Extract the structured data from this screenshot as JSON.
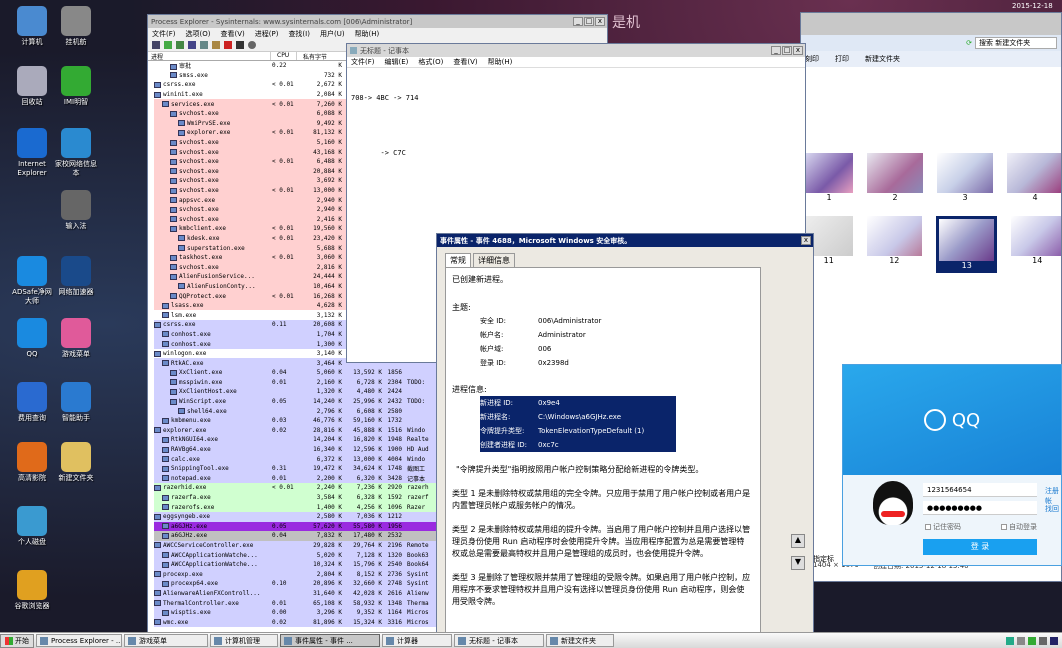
{
  "desktop": {
    "top_text": "是机",
    "date_time": "2015-12-18",
    "icons": [
      "计算机",
      "挂机舫",
      "回收站",
      "IMI明智",
      "Internet Explorer",
      "家校网络信息本",
      "输入法",
      "ADSafe净网大师",
      "网络加速器",
      "QQ",
      "游戏菜单",
      "费用查询",
      "智能助手",
      "高清影院",
      "新建文件夹",
      "个人磁盘",
      "谷歌浏览器"
    ]
  },
  "procexp": {
    "title": "Process Explorer - Sysinternals: www.sysinternals.com [006\\Administrator]",
    "menu": [
      "文件(F)",
      "选项(O)",
      "查看(V)",
      "进程(P)",
      "查找(I)",
      "用户(U)",
      "帮助(H)"
    ],
    "columns": [
      "进程",
      "CPU",
      "私有字节"
    ],
    "rows": [
      [
        "审批",
        "0.22",
        "K",
        "",
        "",
        ""
      ],
      [
        "smss.exe",
        "",
        "732 K",
        "",
        "",
        ""
      ],
      [
        "csrss.exe",
        "< 0.01",
        "2,672 K",
        "",
        "",
        ""
      ],
      [
        "wininit.exe",
        "",
        "2,084 K",
        "",
        "",
        ""
      ],
      [
        "services.exe",
        "< 0.01",
        "7,260 K",
        "",
        "",
        ""
      ],
      [
        "svchost.exe",
        "",
        "6,088 K",
        "",
        "",
        ""
      ],
      [
        "WmiPrvSE.exe",
        "",
        "9,492 K",
        "",
        "",
        ""
      ],
      [
        "explorer.exe",
        "< 0.01",
        "81,132 K",
        "",
        "",
        ""
      ],
      [
        "svchost.exe",
        "",
        "5,160 K",
        "",
        "",
        ""
      ],
      [
        "svchost.exe",
        "",
        "43,168 K",
        "",
        "",
        ""
      ],
      [
        "svchost.exe",
        "< 0.01",
        "6,488 K",
        "",
        "",
        ""
      ],
      [
        "svchost.exe",
        "",
        "20,884 K",
        "",
        "",
        ""
      ],
      [
        "svchost.exe",
        "",
        "3,692 K",
        "",
        "",
        ""
      ],
      [
        "svchost.exe",
        "< 0.01",
        "13,000 K",
        "",
        "",
        ""
      ],
      [
        "appsvc.exe",
        "",
        "2,940 K",
        "",
        "",
        ""
      ],
      [
        "svchost.exe",
        "",
        "2,940 K",
        "",
        "",
        ""
      ],
      [
        "svchost.exe",
        "",
        "2,416 K",
        "",
        "",
        ""
      ],
      [
        "kmbclient.exe",
        "< 0.01",
        "19,560 K",
        "",
        "",
        ""
      ],
      [
        "kdesk.exe",
        "< 0.01",
        "23,420 K",
        "",
        "",
        ""
      ],
      [
        "superstation.exe",
        "",
        "5,688 K",
        "",
        "",
        ""
      ],
      [
        "taskhost.exe",
        "< 0.01",
        "3,060 K",
        "",
        "",
        ""
      ],
      [
        "svchost.exe",
        "",
        "2,816 K",
        "",
        "",
        ""
      ],
      [
        "AlienFusionService...",
        "",
        "24,444 K",
        "",
        "",
        ""
      ],
      [
        "AlienFusionConty...",
        "",
        "10,464 K",
        "",
        "",
        ""
      ],
      [
        "QQProtect.exe",
        "< 0.01",
        "16,268 K",
        "",
        "",
        ""
      ],
      [
        "lsass.exe",
        "",
        "4,628 K",
        "",
        "",
        ""
      ],
      [
        "lsm.exe",
        "",
        "3,132 K",
        "",
        "",
        ""
      ],
      [
        "csrss.exe",
        "0.11",
        "20,608 K",
        "",
        "",
        ""
      ],
      [
        "conhost.exe",
        "",
        "1,704 K",
        "",
        "",
        ""
      ],
      [
        "conhost.exe",
        "",
        "1,300 K",
        "",
        "",
        ""
      ],
      [
        "winlogon.exe",
        "",
        "3,140 K",
        "",
        "",
        ""
      ],
      [
        "RtkAC.exe",
        "",
        "3,464 K",
        "",
        "",
        ""
      ],
      [
        "XxClient.exe",
        "0.04",
        "5,060 K",
        "13,592 K",
        "1856",
        ""
      ],
      [
        "msspiwin.exe",
        "0.01",
        "2,160 K",
        "6,728 K",
        "2304",
        "TODO:"
      ],
      [
        "XxClientHost.exe",
        "",
        "1,320 K",
        "4,480 K",
        "2424",
        ""
      ],
      [
        "WinScript.exe",
        "0.05",
        "14,240 K",
        "25,996 K",
        "2432",
        "TODO:"
      ],
      [
        "shell64.exe",
        "",
        "2,796 K",
        "6,608 K",
        "2580",
        ""
      ],
      [
        "kmbmenu.exe",
        "0.03",
        "46,776 K",
        "59,160 K",
        "1732",
        ""
      ],
      [
        "explorer.exe",
        "0.02",
        "28,816 K",
        "45,888 K",
        "1516",
        "Windo"
      ],
      [
        "RtkNGUI64.exe",
        "",
        "14,204 K",
        "16,820 K",
        "1948",
        "Realte"
      ],
      [
        "RAVBg64.exe",
        "",
        "16,340 K",
        "12,596 K",
        "1900",
        "HD Aud"
      ],
      [
        "calc.exe",
        "",
        "6,372 K",
        "13,000 K",
        "4004",
        "Windo"
      ],
      [
        "SnippingTool.exe",
        "0.31",
        "19,472 K",
        "34,624 K",
        "1748",
        "截图工"
      ],
      [
        "notepad.exe",
        "0.01",
        "2,200 K",
        "6,320 K",
        "3428",
        "记事本"
      ],
      [
        "razerhid.exe",
        "< 0.01",
        "2,240 K",
        "7,236 K",
        "2920",
        "razerh"
      ],
      [
        "razerfa.exe",
        "",
        "3,584 K",
        "6,328 K",
        "1592",
        "razerf"
      ],
      [
        "razerofs.exe",
        "",
        "1,400 K",
        "4,256 K",
        "1096",
        "Razer"
      ],
      [
        "eggsyngeb.exe",
        "",
        "2,580 K",
        "7,036 K",
        "1212",
        ""
      ],
      [
        "a6GJHz.exe",
        "0.05",
        "57,620 K",
        "55,580 K",
        "1956",
        ""
      ],
      [
        "a6GJHz.exe",
        "0.04",
        "7,832 K",
        "17,480 K",
        "2532",
        ""
      ],
      [
        "AWCCServiceController.exe",
        "",
        "29,828 K",
        "29,764 K",
        "2196",
        "Remote"
      ],
      [
        "AWCCApplicationWatche...",
        "",
        "5,020 K",
        "7,128 K",
        "1320",
        "Book63"
      ],
      [
        "AWCCApplicationWatche...",
        "",
        "10,324 K",
        "15,796 K",
        "2540",
        "Book64"
      ],
      [
        "procexp.exe",
        "",
        "2,804 K",
        "8,152 K",
        "2736",
        "Sysint"
      ],
      [
        "procexp64.exe",
        "0.10",
        "20,896 K",
        "32,660 K",
        "2748",
        "Sysint"
      ],
      [
        "AlienwareAlienFXControll...",
        "",
        "31,640 K",
        "42,028 K",
        "2616",
        "Alienw"
      ],
      [
        "ThermalController.exe",
        "0.01",
        "65,108 K",
        "58,932 K",
        "1348",
        "Therma"
      ],
      [
        "wisptis.exe",
        "0.00",
        "3,296 K",
        "9,352 K",
        "1164",
        "Micros"
      ],
      [
        "wmc.exe",
        "0.02",
        "81,896 K",
        "15,324 K",
        "3316",
        "Micros"
      ]
    ]
  },
  "notepad": {
    "title": "无标题 - 记事本",
    "menu": [
      "文件(F)",
      "编辑(E)",
      "格式(O)",
      "查看(V)",
      "帮助(H)"
    ],
    "lines": [
      "708-> 4BC -> 714",
      "",
      "       -> C7C"
    ]
  },
  "explorer_bg": {
    "search": "搜索 新建文件夹",
    "toolbar": [
      "刻印",
      "打印",
      "新建文件夹"
    ],
    "thumbs": [
      "1",
      "2",
      "3",
      "4",
      "11",
      "12",
      "13",
      "14"
    ],
    "status": [
      "名称",
      "创建日期: 2015-12-18 13:40"
    ],
    "size_label": "1404 × 1079",
    "other_text": [
      "指定标",
      "2015-12"
    ]
  },
  "event": {
    "title": "事件属性 - 事件 4688，Microsoft Windows 安全审核。",
    "tabs": [
      "常规",
      "详细信息"
    ],
    "intro": "已创建新进程。",
    "subject_label": "主题:",
    "subject": [
      [
        "安全 ID:",
        "006\\Administrator"
      ],
      [
        "帐户名:",
        "Administrator"
      ],
      [
        "帐户域:",
        "006"
      ],
      [
        "登录 ID:",
        "0x2398d"
      ]
    ],
    "process_label": "进程信息:",
    "process": [
      [
        "新进程 ID:",
        "0x9e4"
      ],
      [
        "新进程名:",
        "C:\\Windows\\a6GJHz.exe"
      ],
      [
        "令牌提升类型:",
        "TokenElevationTypeDefault (1)"
      ],
      [
        "创建者进程 ID:",
        "0xc7c"
      ]
    ],
    "p1": "\"令牌提升类型\"指明按照用户帐户控制策略分配给新进程的令牌类型。",
    "p2": "类型 1 是未删除特权或禁用组的完全令牌。只应用于禁用了用户帐户控制或者用户是内置管理员帐户或服务帐户的情况。",
    "p3": "类型 2 是未删除特权或禁用组的提升令牌。当启用了用户帐户控制并且用户选择以管理员身份使用 Run 启动程序时会使用提升令牌。当应用程序配置为总是需要管理特权或总是需要最高特权并且用户是管理组的成员时，也会使用提升令牌。",
    "p4": "类型 3 是删除了管理权限并禁用了管理组的受限令牌。如果启用了用户帐户控制，应用程序不要求管理特权并且用户没有选择以管理员身份使用 Run 启动程序，则会使用受限令牌。"
  },
  "qq": {
    "logo": "QQ",
    "account": "1231564654",
    "password_mask": "●●●●●●●●●",
    "remember": "记住密码",
    "autologin": "自动登录",
    "login": "登 录",
    "register": "注册帐",
    "retrieve": "找回"
  },
  "taskbar": {
    "start": "开始",
    "tasks": [
      "Process Explorer - ...",
      "游戏菜单",
      "计算机管理",
      "事件属性 - 事件 ...",
      "计算器",
      "无标题 - 记事本",
      "新建文件夹"
    ]
  }
}
